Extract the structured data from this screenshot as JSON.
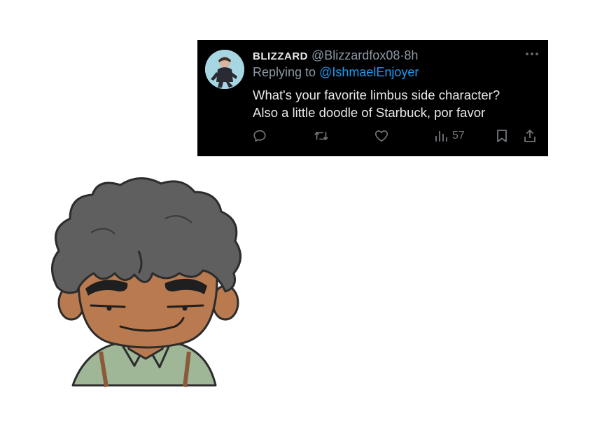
{
  "tweet": {
    "display_name": "BLIZZARD",
    "handle": "@Blizzardfox08",
    "separator": "·",
    "time": "8h",
    "replying_prefix": "Replying to",
    "replying_to": "@IshmaelEnjoyer",
    "text_line1": "What's your favorite limbus side character?",
    "text_line2": "Also a little doodle of Starbuck, por favor",
    "views": "57"
  },
  "icons": {
    "more": "more-dots-icon",
    "reply": "reply-bubble-icon",
    "retweet": "retweet-icon",
    "like": "heart-icon",
    "views": "views-bar-chart-icon",
    "bookmark": "bookmark-icon",
    "share": "share-upload-icon"
  },
  "colors": {
    "card_background": "#000000",
    "primary_text": "#e7e9ea",
    "secondary_text": "#8b98a5",
    "mention": "#1d9bf0",
    "icon": "#71767b",
    "skin": "#b97a4f",
    "hair": "#5f5f5f",
    "shirt": "#9fb797"
  },
  "drawing": {
    "subject": "doodle-portrait"
  }
}
